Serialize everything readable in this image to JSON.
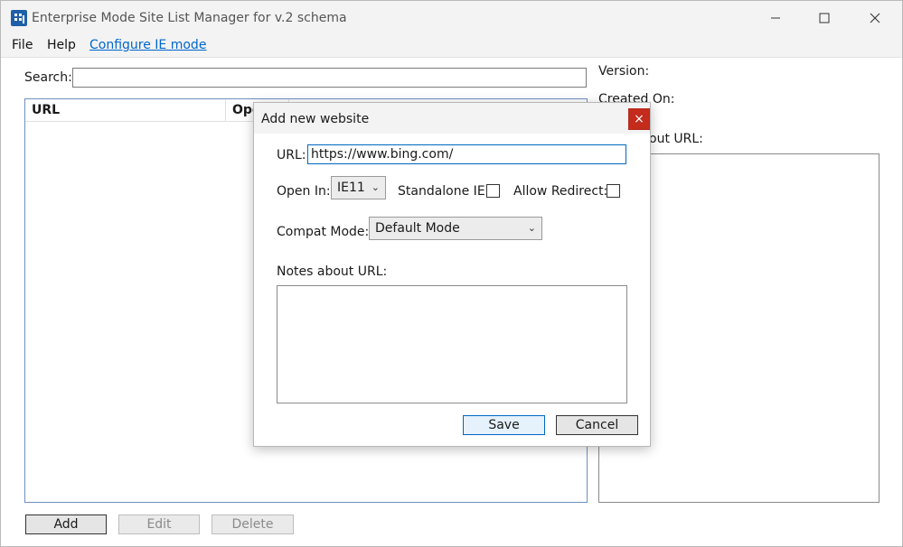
{
  "window": {
    "title": "Enterprise Mode Site List Manager for v.2 schema"
  },
  "menu": {
    "file": "File",
    "help": "Help",
    "configure": "Configure IE mode"
  },
  "main": {
    "search_label": "Search:",
    "search_value": "",
    "columns": [
      "URL",
      "Ope"
    ],
    "version_label": "Version:",
    "created_on_label": "Created On:",
    "notes_label": "Notes about URL:",
    "notes_label_visible": "out URL:",
    "buttons": {
      "add": "Add",
      "edit": "Edit",
      "delete": "Delete"
    }
  },
  "dialog": {
    "title": "Add new website",
    "close_glyph": "×",
    "url_label": "URL:",
    "url_value": "https://www.bing.com/",
    "open_in_label": "Open In:",
    "open_in_value": "IE11",
    "standalone_label": "Standalone IE:",
    "standalone_checked": false,
    "allow_redirect_label": "Allow Redirect:",
    "allow_redirect_checked": false,
    "compat_label": "Compat Mode:",
    "compat_value": "Default Mode",
    "notes_label": "Notes about URL:",
    "notes_value": "",
    "save": "Save",
    "cancel": "Cancel"
  },
  "icons": {
    "app": "building-icon",
    "minimize": "minimize-icon",
    "maximize": "maximize-icon",
    "close": "close-icon",
    "chevron": "chevron-down-icon"
  },
  "colors": {
    "accent": "#0067c0",
    "close_red": "#c42b1c",
    "link": "#0066cc"
  }
}
